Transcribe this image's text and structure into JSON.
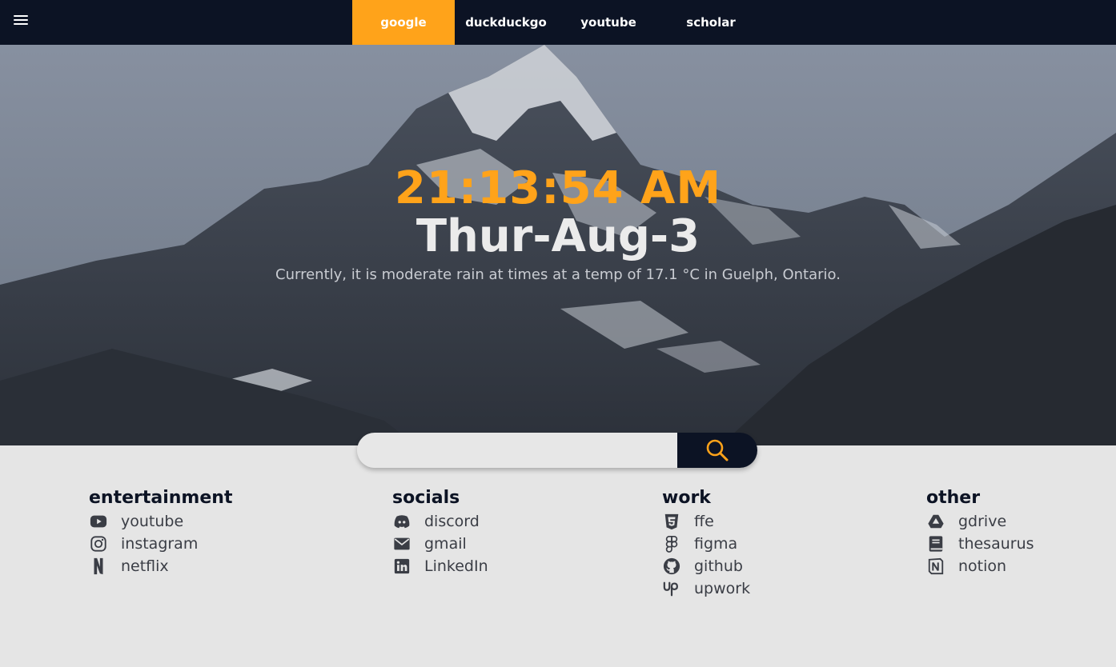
{
  "nav": {
    "tabs": [
      {
        "label": "google",
        "active": true
      },
      {
        "label": "duckduckgo",
        "active": false
      },
      {
        "label": "youtube",
        "active": false
      },
      {
        "label": "scholar",
        "active": false
      }
    ]
  },
  "hero": {
    "time": "21:13:54 AM",
    "date": "Thur-Aug-3",
    "weather": "Currently, it is moderate rain at times at a temp of 17.1 °C in Guelph, Ontario."
  },
  "search": {
    "value": "",
    "placeholder": ""
  },
  "categories": [
    {
      "title": "entertainment",
      "links": [
        {
          "label": "youtube",
          "icon": "youtube-icon"
        },
        {
          "label": "instagram",
          "icon": "instagram-icon"
        },
        {
          "label": "netflix",
          "icon": "netflix-icon"
        }
      ]
    },
    {
      "title": "socials",
      "links": [
        {
          "label": "discord",
          "icon": "discord-icon"
        },
        {
          "label": "gmail",
          "icon": "mail-icon"
        },
        {
          "label": "LinkedIn",
          "icon": "linkedin-icon"
        }
      ]
    },
    {
      "title": "work",
      "links": [
        {
          "label": "ffe",
          "icon": "css3-icon"
        },
        {
          "label": "figma",
          "icon": "figma-icon"
        },
        {
          "label": "github",
          "icon": "github-icon"
        },
        {
          "label": "upwork",
          "icon": "upwork-icon"
        }
      ]
    },
    {
      "title": "other",
      "links": [
        {
          "label": "gdrive",
          "icon": "google-drive-icon"
        },
        {
          "label": "thesaurus",
          "icon": "book-icon"
        },
        {
          "label": "notion",
          "icon": "notion-icon"
        }
      ]
    }
  ],
  "colors": {
    "accent": "#ffa31a",
    "navy": "#0c1324",
    "page_background": "#e5e5e5"
  }
}
